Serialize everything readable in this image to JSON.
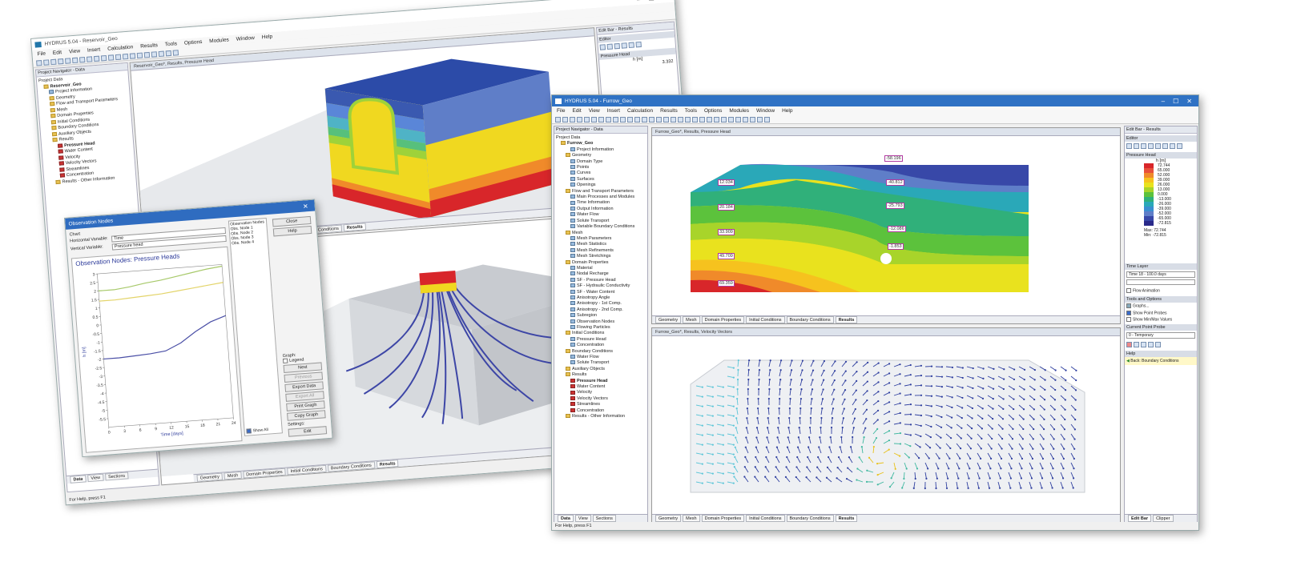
{
  "win1": {
    "title": "HYDRUS 5.04 - Reservoir_Geo",
    "menus": [
      "File",
      "Edit",
      "View",
      "Insert",
      "Calculation",
      "Results",
      "Tools",
      "Options",
      "Modules",
      "Window",
      "Help"
    ],
    "navigator": {
      "title": "Project Navigator - Data",
      "root": "Project Data",
      "project": "Reservoir_Geo",
      "items": [
        "Project Information",
        "Geometry",
        "Flow and Transport Parameters",
        "Mesh",
        "Domain Properties",
        "Initial Conditions",
        "Boundary Conditions",
        "Auxiliary Objects",
        "Results",
        "Pressure Head",
        "Water Content",
        "Velocity",
        "Velocity Vectors",
        "Streamlines",
        "Concentration",
        "Results - Other Information"
      ]
    },
    "view_top": {
      "title": "Reservoir_Geo*, Results, Pressure Head",
      "tabs": [
        "Conditions",
        "Results"
      ]
    },
    "view_bottom": {
      "tabs": [
        "Geometry",
        "Mesh",
        "Domain Properties",
        "Initial Conditions",
        "Boundary Conditions",
        "Results"
      ]
    },
    "nav_tabs": [
      "Data",
      "View",
      "Sections"
    ],
    "status": "For Help, press F1",
    "editbar": {
      "title": "Edit Bar - Results",
      "editor": "Editor",
      "ph": "Pressure Head",
      "unit": "h [m]",
      "value": "3.332"
    }
  },
  "dialog": {
    "title": "Observation Nodes",
    "chart_group": "Chart",
    "hvar_label": "Horizontal Variable:",
    "hvar": "Time",
    "vvar_label": "Vertical Variable:",
    "vvar": "Pressure head",
    "list_title": "Observation Nodes",
    "nodes": [
      "Obs. Node 1",
      "Obs. Node 2",
      "Obs. Node 3",
      "Obs. Node 4"
    ],
    "buttons": [
      "Close",
      "Help"
    ],
    "graph_label": "Graph:",
    "legend": "Legend",
    "gbuttons": [
      "Next",
      "Previous",
      "Export Data",
      "Export All",
      "Print Graph",
      "Copy Graph"
    ],
    "show_all": "Show All",
    "settings": "Settings:",
    "edit": "Edit"
  },
  "chart_data": {
    "type": "line",
    "title": "Observation Nodes: Pressure Heads",
    "xlabel": "Time [days]",
    "ylabel": "h [m]",
    "xlim": [
      0,
      24
    ],
    "ylim": [
      -6,
      3
    ],
    "xticks": [
      "0",
      "3",
      "6",
      "9",
      "12",
      "15",
      "18",
      "21",
      "24"
    ],
    "yticks": [
      "3",
      "2.5",
      "2",
      "1.5",
      "1",
      "0.5",
      "0",
      "-0.5",
      "-1",
      "-1.5",
      "-2",
      "-2.5",
      "-3",
      "-3.5",
      "-4",
      "-4.5",
      "-5",
      "-5.5"
    ],
    "series": [
      {
        "color": "#a7c96a",
        "x": [
          0,
          3,
          6,
          9,
          12,
          15,
          18,
          21,
          24
        ],
        "y": [
          2,
          2,
          2.1,
          2.25,
          2.35,
          2.5,
          2.65,
          2.8,
          2.9
        ]
      },
      {
        "color": "#e3d46a",
        "x": [
          0,
          3,
          6,
          9,
          12,
          15,
          18,
          21,
          24
        ],
        "y": [
          1.4,
          1.4,
          1.45,
          1.5,
          1.55,
          1.65,
          1.75,
          1.85,
          1.95
        ]
      },
      {
        "color": "#4a4fa6",
        "x": [
          0,
          3,
          6,
          9,
          12,
          15,
          18,
          21,
          24
        ],
        "y": [
          -2,
          -2,
          -1.95,
          -1.9,
          -1.8,
          -1.4,
          -0.8,
          -0.3,
          0
        ]
      }
    ]
  },
  "win2": {
    "title": "HYDRUS 5.04 - Furrow_Geo",
    "menus": [
      "File",
      "Edit",
      "View",
      "Insert",
      "Calculation",
      "Results",
      "Tools",
      "Options",
      "Modules",
      "Window",
      "Help"
    ],
    "navigator": {
      "title": "Project Navigator - Data",
      "root": "Project Data",
      "project": "Furrow_Geo",
      "items": [
        "Project Information",
        "Geometry",
        "Domain Type",
        "Points",
        "Curves",
        "Surfaces",
        "Openings",
        "Flow and Transport Parameters",
        "Main Processes and Modules",
        "Time Information",
        "Output Information",
        "Water Flow",
        "Solute Transport",
        "Variable Boundary Conditions",
        "Mesh",
        "Mesh Parameters",
        "Mesh Statistics",
        "Mesh Refinements",
        "Mesh Stretchings",
        "Domain Properties",
        "Material",
        "Nodal Recharge",
        "SF - Pressure Head",
        "SF - Hydraulic Conductivity",
        "SF - Water Content",
        "Anisotropy Angle",
        "Anisotropy - 1st Comp.",
        "Anisotropy - 2nd Comp.",
        "Subregion",
        "Observation Nodes",
        "Flowing Particles",
        "Initial Conditions",
        "Pressure Head",
        "Concentration",
        "Boundary Conditions",
        "Water Flow",
        "Solute Transport",
        "Auxiliary Objects",
        "Results",
        "Pressure Head",
        "Water Content",
        "Velocity",
        "Velocity Vectors",
        "Streamlines",
        "Concentration",
        "Results - Other Information"
      ]
    },
    "view_top": {
      "title": "Furrow_Geo*, Results, Pressure Head",
      "labels": [
        "-58.196",
        "-40.812",
        "-25.793",
        "-12.086",
        "-1.853",
        "12.034",
        "20.184",
        "33.909",
        "49.709",
        "69.359"
      ],
      "tabs": [
        "Geometry",
        "Mesh",
        "Domain Properties",
        "Initial Conditions",
        "Boundary Conditions",
        "Results"
      ]
    },
    "view_bottom": {
      "title": "Furrow_Geo*, Results, Velocity Vectors",
      "tabs": [
        "Geometry",
        "Mesh",
        "Domain Properties",
        "Initial Conditions",
        "Boundary Conditions",
        "Results"
      ]
    },
    "nav_tabs": [
      "Data",
      "View",
      "Sections"
    ],
    "status": "For Help, press F1",
    "editbar": {
      "title": "Edit Bar - Results",
      "editor": "Editor",
      "ph": "Pressure Head",
      "unit": "h [m]",
      "legend": [
        {
          "v": "72.744",
          "c": "#d8262a"
        },
        {
          "v": "65.000",
          "c": "#e8503a"
        },
        {
          "v": "52.000",
          "c": "#f08a2a"
        },
        {
          "v": "39.000",
          "c": "#f6c21e"
        },
        {
          "v": "26.000",
          "c": "#e9e21e"
        },
        {
          "v": "13.000",
          "c": "#a8d42a"
        },
        {
          "v": "0.000",
          "c": "#5cc23c"
        },
        {
          "v": "-13.000",
          "c": "#30b07a"
        },
        {
          "v": "-26.000",
          "c": "#2aa8b8"
        },
        {
          "v": "-39.000",
          "c": "#3a8ed0"
        },
        {
          "v": "-52.000",
          "c": "#5f7ec8"
        },
        {
          "v": "-65.000",
          "c": "#3848a8"
        },
        {
          "v": "-72.815",
          "c": "#2a2a8a"
        }
      ],
      "max_label": "Max:",
      "max": "72.744",
      "min_label": "Min:",
      "min": "-72.815",
      "time_layer": "Time Layer",
      "time": "Time 18 - 100.0 days",
      "flow_anim": "Flow Animation",
      "tools": "Tools and Options",
      "graphs": "Graphs...",
      "show_probes": "Show Point Probes",
      "show_minmax": "Show Min/Max Values",
      "probe": "Current Point Probe",
      "probe_val": "0 - Temporary",
      "help": "Help",
      "help_item": "Back: Boundary Conditions",
      "bottom_tabs": [
        "Edit Bar",
        "Clipper"
      ]
    }
  }
}
